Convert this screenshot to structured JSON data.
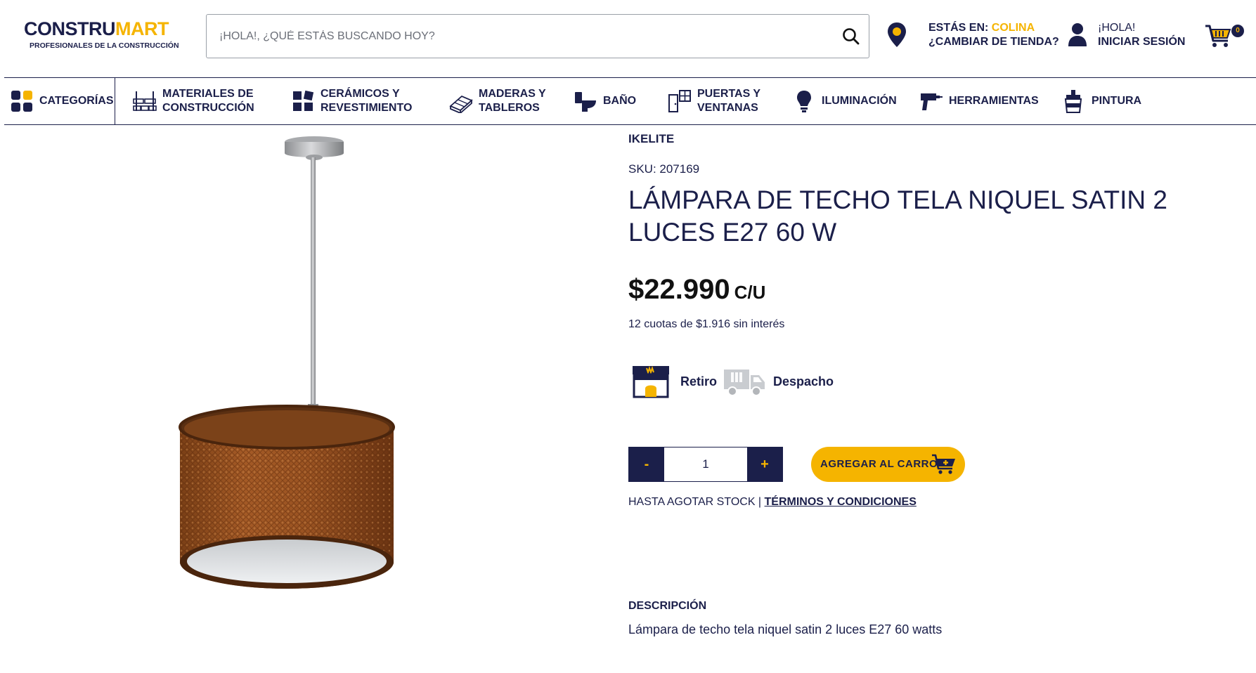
{
  "colors": {
    "brand_navy": "#1b1f4a",
    "brand_yellow": "#f5b400"
  },
  "header": {
    "logo": {
      "name_part1": "CONSTRU",
      "name_part2": "MART",
      "tagline": "PROFESIONALES DE LA CONSTRUCCIÓN"
    },
    "search": {
      "placeholder": "¡HOLA!, ¿QUÉ ESTÁS BUSCANDO HOY?",
      "value": "",
      "icon": "search-icon"
    },
    "store": {
      "prefix": "ESTÁS EN: ",
      "city": "COLINA",
      "change_label": "¿CAMBIAR DE TIENDA?",
      "icon": "location-pin-icon"
    },
    "login": {
      "greeting": "¡HOLA!",
      "label": "INICIAR SESIÓN",
      "icon": "user-icon"
    },
    "cart": {
      "count": "0",
      "icon": "shopping-cart-icon"
    }
  },
  "nav": {
    "categories_label": "CATEGORÍAS",
    "items": [
      {
        "line1": "MATERIALES DE",
        "line2": "CONSTRUCCIÓN",
        "icon": "construction-materials-icon"
      },
      {
        "line1": "CERÁMICOS Y",
        "line2": "REVESTIMIENTO",
        "icon": "tiles-icon"
      },
      {
        "line1": "MADERAS Y",
        "line2": "TABLEROS",
        "icon": "wood-boards-icon"
      },
      {
        "line1": "BAÑO",
        "line2": "",
        "icon": "toilet-icon"
      },
      {
        "line1": "PUERTAS Y",
        "line2": "VENTANAS",
        "icon": "door-window-icon"
      },
      {
        "line1": "ILUMINACIÓN",
        "line2": "",
        "icon": "lightbulb-icon"
      },
      {
        "line1": "HERRAMIENTAS",
        "line2": "",
        "icon": "drill-icon"
      },
      {
        "line1": "PINTURA",
        "line2": "",
        "icon": "paint-can-icon"
      }
    ]
  },
  "product": {
    "brand": "IKELITE",
    "sku": "SKU: 207169",
    "title": "LÁMPARA DE TECHO TELA NIQUEL SATIN 2 LUCES E27 60 W",
    "price": "$22.990",
    "unit": "C/U",
    "installments": "12 cuotas de $1.916 sin interés",
    "delivery": {
      "pickup_label": "Retiro",
      "shipping_label": "Despacho"
    },
    "quantity": {
      "minus": "-",
      "value": "1",
      "plus": "+"
    },
    "add_to_cart": "AGREGAR AL CARRO",
    "stock_note": "HASTA AGOTAR STOCK | ",
    "terms_label": "TÉRMINOS Y CONDICIONES",
    "description_title": "DESCRIPCIÓN",
    "description": "Lámpara de techo tela niquel satin 2 luces E27 60 watts"
  }
}
